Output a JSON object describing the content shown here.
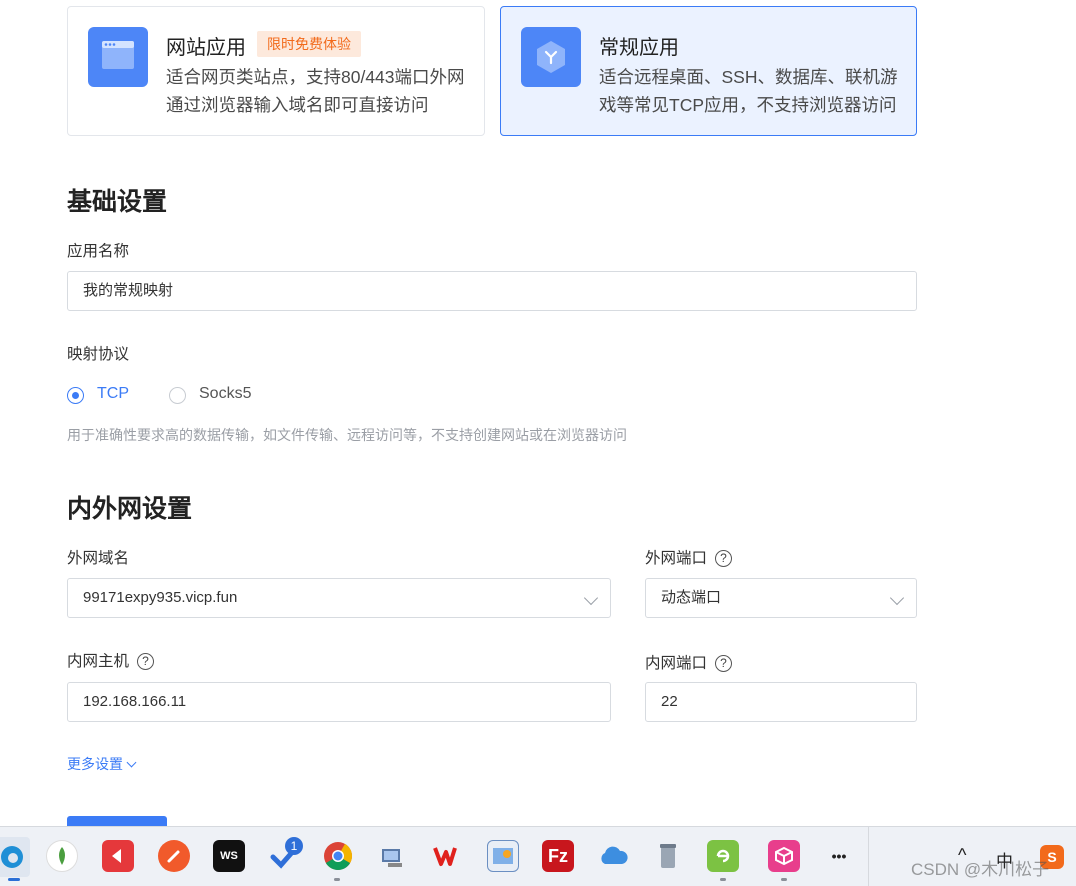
{
  "cards": {
    "web": {
      "title": "网站应用",
      "badge": "限时免费体验",
      "desc": "适合网页类站点，支持80/443端口外网通过浏览器输入域名即可直接访问",
      "icon": "browser-window-icon"
    },
    "general": {
      "title": "常规应用",
      "desc": "适合远程桌面、SSH、数据库、联机游戏等常见TCP应用，不支持浏览器访问",
      "icon": "cube-icon"
    }
  },
  "basic": {
    "title": "基础设置",
    "app_name_label": "应用名称",
    "app_name_value": "我的常规映射",
    "protocol_label": "映射协议",
    "protocol_options": [
      "TCP",
      "Socks5"
    ],
    "protocol_selected": "TCP",
    "protocol_hint": "用于准确性要求高的数据传输，如文件传输、远程访问等，不支持创建网站或在浏览器访问"
  },
  "network": {
    "title": "内外网设置",
    "ext_domain_label": "外网域名",
    "ext_domain_value": "99171expy935.vicp.fun",
    "ext_port_label": "外网端口",
    "ext_port_value": "动态端口",
    "int_host_label": "内网主机",
    "int_host_value": "192.168.166.11",
    "int_port_label": "内网端口",
    "int_port_value": "22",
    "help_glyph": "?",
    "more_settings": "更多设置"
  },
  "taskbar": {
    "todo_badge": "1",
    "more_glyph": "•••",
    "ime": "中",
    "up_arrow": "^"
  },
  "watermark": "CSDN @木川松子",
  "colors": {
    "accent": "#3b7bf6",
    "badge_text": "#f26a1b",
    "badge_bg": "#fde9dc"
  }
}
